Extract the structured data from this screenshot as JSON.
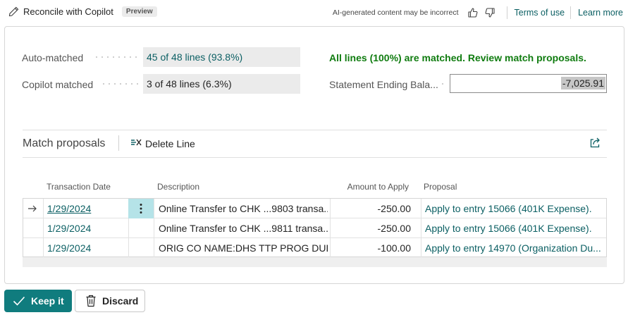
{
  "header": {
    "title": "Reconcile with Copilot",
    "badge": "Preview",
    "disclaimer": "AI-generated content may be incorrect",
    "terms_label": "Terms of use",
    "learn_label": "Learn more",
    "icons": [
      "pencil-icon",
      "thumbs-up-icon",
      "thumbs-down-icon"
    ]
  },
  "summary": {
    "auto_label": "Auto-matched",
    "auto_value": "45 of 48 lines (93.8%)",
    "copilot_label": "Copilot matched",
    "copilot_value": "3 of 48 lines (6.3%)",
    "all_matched": "All lines (100%) are matched. Review match proposals.",
    "balance_label": "Statement Ending Bala...",
    "balance_value": "-7,025.91"
  },
  "proposals": {
    "title": "Match proposals",
    "delete_label": "Delete Line",
    "columns": {
      "date": "Transaction Date",
      "description": "Description",
      "amount": "Amount to Apply",
      "proposal": "Proposal"
    },
    "rows": [
      {
        "date": "1/29/2024",
        "description": "Online Transfer to CHK ...9803 transa...",
        "amount": "-250.00",
        "proposal": "Apply to entry 15066 (401K Expense)."
      },
      {
        "date": "1/29/2024",
        "description": "Online Transfer to CHK ...9811 transa...",
        "amount": "-250.00",
        "proposal": "Apply to entry 15066 (401K Expense)."
      },
      {
        "date": "1/29/2024",
        "description": "ORIG CO NAME:DHS TTP PROG DUE ...",
        "amount": "-100.00",
        "proposal": "Apply to entry 14970 (Organization Du..."
      }
    ]
  },
  "footer": {
    "keep_label": "Keep it",
    "discard_label": "Discard"
  },
  "colors": {
    "accent": "#107c7e",
    "link": "#0b5f63",
    "success": "#107c10",
    "selected_cell": "#b5e3e8"
  }
}
